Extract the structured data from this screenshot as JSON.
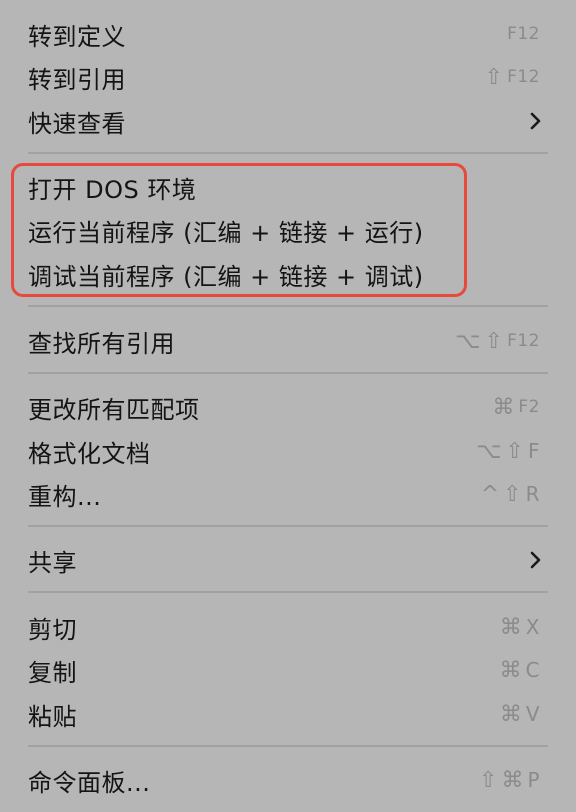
{
  "menu": {
    "items": [
      {
        "label": "转到定义",
        "shortcut": "F12"
      },
      {
        "label": "转到引用",
        "shortcut": "⇧ F12"
      },
      {
        "label": "快速查看",
        "submenu": true
      },
      {
        "label": "打开 DOS 环境"
      },
      {
        "label": "运行当前程序 (汇编 + 链接 + 运行)"
      },
      {
        "label": "调试当前程序 (汇编 + 链接 + 调试)"
      },
      {
        "label": "查找所有引用",
        "shortcut": "⌥⇧ F12"
      },
      {
        "label": "更改所有匹配项",
        "shortcut": "⌘ F2"
      },
      {
        "label": "格式化文档",
        "shortcut": "⌥⇧ F"
      },
      {
        "label": "重构...",
        "shortcut": "^⇧ R"
      },
      {
        "label": "共享",
        "submenu": true
      },
      {
        "label": "剪切",
        "shortcut": "⌘ X"
      },
      {
        "label": "复制",
        "shortcut": "⌘ C"
      },
      {
        "label": "粘贴",
        "shortcut": "⌘ V"
      },
      {
        "label": "命令面板...",
        "shortcut": "⇧⌘ P"
      }
    ]
  },
  "colors": {
    "highlight_border": "#e8493d",
    "menu_background": "#b5b6b5",
    "text": "#141414",
    "shortcut_text": "#8a8b8a"
  }
}
